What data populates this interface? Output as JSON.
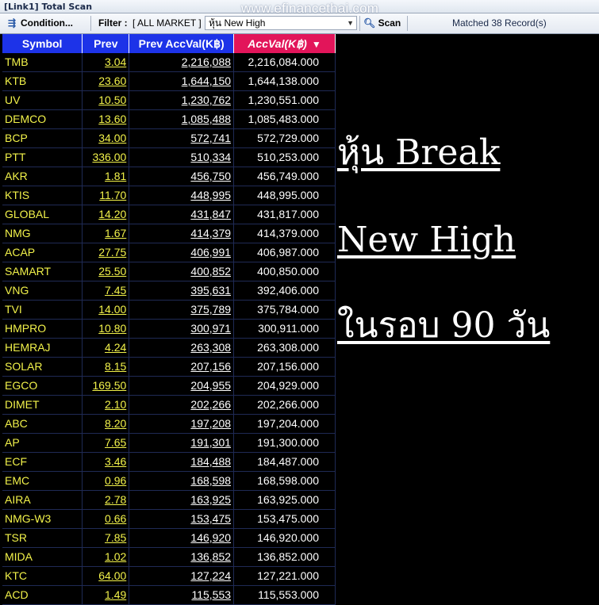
{
  "window": {
    "title": "[Link1] Total Scan"
  },
  "watermark": "www.efinancethai.com",
  "toolbar": {
    "condition_label": "Condition...",
    "filter_label": "Filter :",
    "filter_value": "[ ALL MARKET ]",
    "combo_value": "หุ้น New High",
    "scan_label": "Scan",
    "matched_text": "Matched 38 Record(s)"
  },
  "table": {
    "headers": [
      "Symbol",
      "Prev",
      "Prev AccVal(K฿)",
      "AccVal(K฿)"
    ],
    "sorted_column": "AccVal(K฿)",
    "rows": [
      [
        "TMB",
        "3.04",
        "2,216,088",
        "2,216,084.000"
      ],
      [
        "KTB",
        "23.60",
        "1,644,150",
        "1,644,138.000"
      ],
      [
        "UV",
        "10.50",
        "1,230,762",
        "1,230,551.000"
      ],
      [
        "DEMCO",
        "13.60",
        "1,085,488",
        "1,085,483.000"
      ],
      [
        "BCP",
        "34.00",
        "572,741",
        "572,729.000"
      ],
      [
        "PTT",
        "336.00",
        "510,334",
        "510,253.000"
      ],
      [
        "AKR",
        "1.81",
        "456,750",
        "456,749.000"
      ],
      [
        "KTIS",
        "11.70",
        "448,995",
        "448,995.000"
      ],
      [
        "GLOBAL",
        "14.20",
        "431,847",
        "431,817.000"
      ],
      [
        "NMG",
        "1.67",
        "414,379",
        "414,379.000"
      ],
      [
        "ACAP",
        "27.75",
        "406,991",
        "406,987.000"
      ],
      [
        "SAMART",
        "25.50",
        "400,852",
        "400,850.000"
      ],
      [
        "VNG",
        "7.45",
        "395,631",
        "392,406.000"
      ],
      [
        "TVI",
        "14.00",
        "375,789",
        "375,784.000"
      ],
      [
        "HMPRO",
        "10.80",
        "300,971",
        "300,911.000"
      ],
      [
        "HEMRAJ",
        "4.24",
        "263,308",
        "263,308.000"
      ],
      [
        "SOLAR",
        "8.15",
        "207,156",
        "207,156.000"
      ],
      [
        "EGCO",
        "169.50",
        "204,955",
        "204,929.000"
      ],
      [
        "DIMET",
        "2.10",
        "202,266",
        "202,266.000"
      ],
      [
        "ABC",
        "8.20",
        "197,208",
        "197,204.000"
      ],
      [
        "AP",
        "7.65",
        "191,301",
        "191,300.000"
      ],
      [
        "ECF",
        "3.46",
        "184,488",
        "184,487.000"
      ],
      [
        "EMC",
        "0.96",
        "168,598",
        "168,598.000"
      ],
      [
        "AIRA",
        "2.78",
        "163,925",
        "163,925.000"
      ],
      [
        "NMG-W3",
        "0.66",
        "153,475",
        "153,475.000"
      ],
      [
        "TSR",
        "7.85",
        "146,920",
        "146,920.000"
      ],
      [
        "MIDA",
        "1.02",
        "136,852",
        "136,852.000"
      ],
      [
        "KTC",
        "64.00",
        "127,224",
        "127,221.000"
      ],
      [
        "ACD",
        "1.49",
        "115,553",
        "115,553.000"
      ]
    ]
  },
  "overlay": {
    "line1": "หุ้น Break",
    "line2": "New High",
    "line3": "ในรอบ 90 วัน"
  },
  "colors": {
    "header_bg": "#1d33e8",
    "header_sorted_bg": "#e2155a",
    "symbol_text": "#f2f24a",
    "value_text": "#ffffff",
    "background": "#000000"
  },
  "icons": {
    "condition": "filter-list-icon",
    "scan": "magnifier-icon",
    "combo": "chevron-down-icon"
  }
}
